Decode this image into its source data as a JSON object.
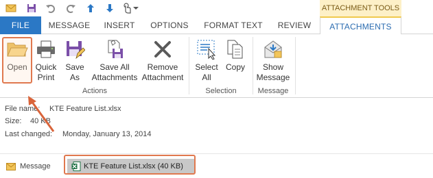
{
  "quick_access": {
    "icons": [
      "envelope-icon",
      "save-icon",
      "undo-icon",
      "redo-icon",
      "up-arrow-icon",
      "down-arrow-icon",
      "touch-mode-icon",
      "customize-dropdown-icon"
    ]
  },
  "context_group": {
    "title": "ATTACHMENT TOOLS"
  },
  "tabs": {
    "file": "FILE",
    "message": "MESSAGE",
    "insert": "INSERT",
    "options": "OPTIONS",
    "format_text": "FORMAT TEXT",
    "review": "REVIEW",
    "attachments": "ATTACHMENTS"
  },
  "ribbon": {
    "open": {
      "line1": "Open"
    },
    "quick_print": {
      "line1": "Quick",
      "line2": "Print"
    },
    "save_as": {
      "line1": "Save",
      "line2": "As"
    },
    "save_all": {
      "line1": "Save All",
      "line2": "Attachments"
    },
    "remove": {
      "line1": "Remove",
      "line2": "Attachment"
    },
    "select_all": {
      "line1": "Select",
      "line2": "All"
    },
    "copy": {
      "line1": "Copy"
    },
    "show_message": {
      "line1": "Show",
      "line2": "Message"
    },
    "groups": {
      "actions": "Actions",
      "selection": "Selection",
      "message": "Message"
    }
  },
  "file_info": {
    "name_label": "File name:",
    "name_value": "KTE Feature List.xlsx",
    "size_label": "Size:",
    "size_value": "40 KB",
    "changed_label": "Last changed:",
    "changed_value": "Monday, January 13, 2014"
  },
  "message_bar": {
    "message_label": "Message",
    "attachment_label": "KTE Feature List.xlsx (40 KB)"
  },
  "colors": {
    "file_tab": "#2b78c5",
    "context_tab_bg": "#fdf0c7",
    "highlight": "#e0784e",
    "attachment_chip": "#c8c8c8"
  }
}
